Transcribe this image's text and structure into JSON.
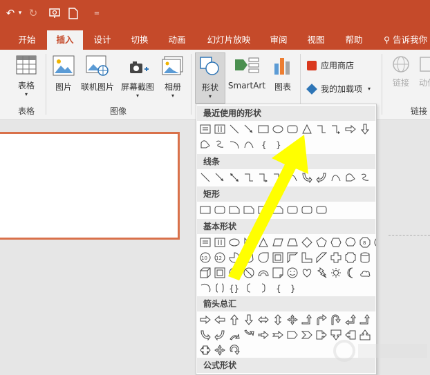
{
  "quick_access": {
    "undo_icon": "undo-icon",
    "redo_icon": "redo-icon",
    "present_icon": "present-from-start-icon",
    "new_icon": "new-document-icon",
    "customize_icon": "customize-qat-icon"
  },
  "tabs": [
    {
      "label": "开始"
    },
    {
      "label": "插入"
    },
    {
      "label": "设计"
    },
    {
      "label": "切换"
    },
    {
      "label": "动画"
    },
    {
      "label": "幻灯片放映"
    },
    {
      "label": "审阅"
    },
    {
      "label": "视图"
    },
    {
      "label": "帮助"
    }
  ],
  "tell_me": "告诉我你",
  "ribbon": {
    "table_label": "表格",
    "picture_label": "图片",
    "online_picture_label": "联机图片",
    "screenshot_label": "屏幕截图",
    "album_label": "相册",
    "shapes_label": "形状",
    "smartart_label": "SmartArt",
    "chart_label": "图表",
    "store_label": "应用商店",
    "my_addins_label": "我的加载项",
    "link_label": "链接",
    "action_label": "动作",
    "group_table": "表格",
    "group_images": "图像",
    "group_links": "链接"
  },
  "shapes_menu": {
    "recent": "最近使用的形状",
    "lines": "线条",
    "rectangles": "矩形",
    "basic": "基本形状",
    "arrows": "箭头总汇",
    "equation": "公式形状"
  },
  "colors": {
    "accent": "#c54a2a",
    "arrow": "#ffff00"
  }
}
